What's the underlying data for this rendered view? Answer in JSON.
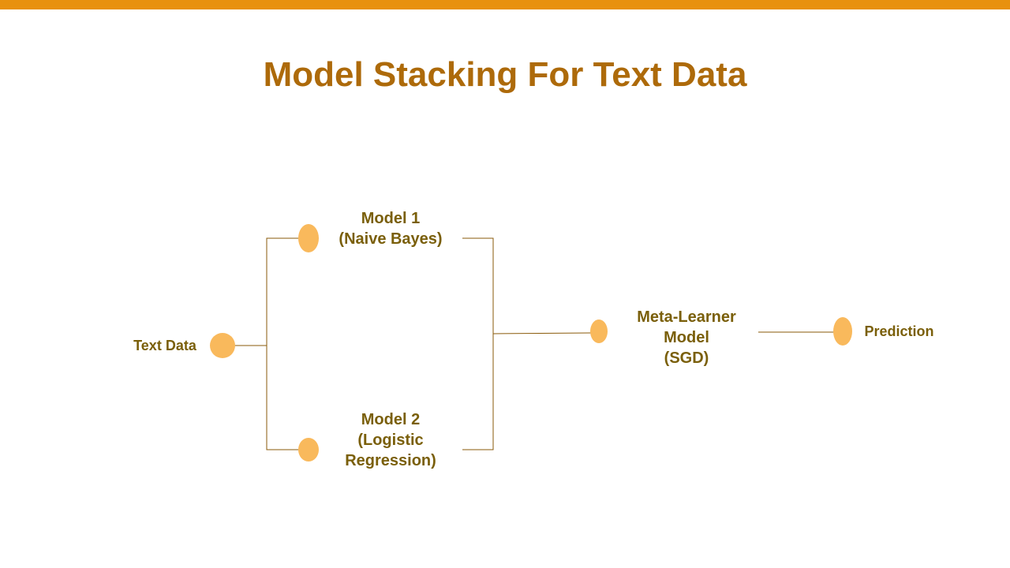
{
  "title": "Model Stacking For Text Data",
  "colors": {
    "accent_bar": "#e8910e",
    "title": "#ad6a0a",
    "node_fill": "#f9b95c",
    "connector": "#8a5a0a",
    "label": "#7a5f0a"
  },
  "nodes": {
    "input": {
      "label": "Text Data"
    },
    "model1": {
      "lines": [
        "Model 1",
        "(Naive Bayes)"
      ]
    },
    "model2": {
      "lines": [
        "Model 2",
        "(Logistic",
        "Regression)"
      ]
    },
    "meta": {
      "lines": [
        "Meta-Learner",
        "Model",
        "(SGD)"
      ]
    },
    "output": {
      "label": "Prediction"
    }
  }
}
